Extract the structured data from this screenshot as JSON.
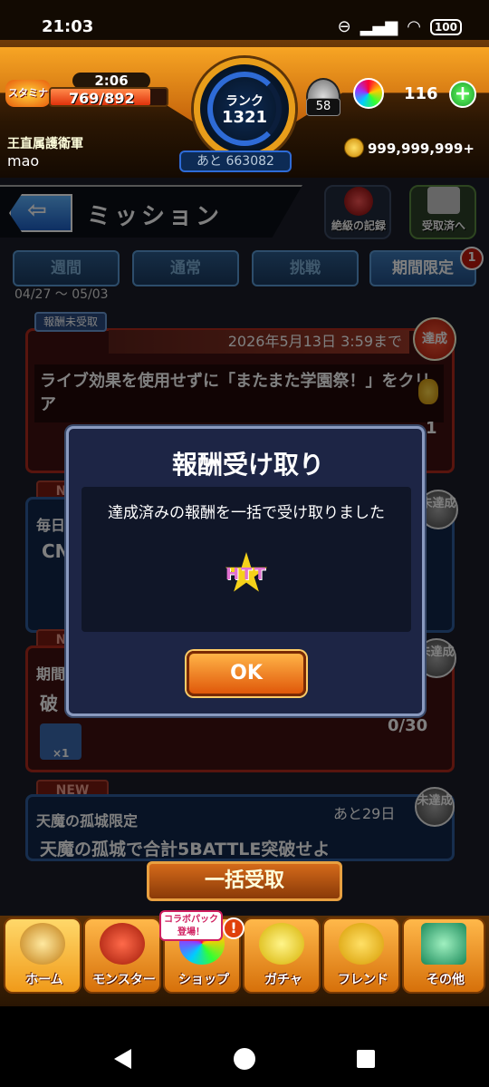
{
  "status": {
    "time": "21:03",
    "battery": "100"
  },
  "hud": {
    "stamina_icon": "スタミナ",
    "stamina_timer": "2:06",
    "stamina_value": "769/892",
    "stamina_fraction": 0.862,
    "rank_label": "ランク",
    "rank_value": "1321",
    "rank_next": "あと 663082",
    "level": "58",
    "orbs": "116",
    "team": "王直属護衛軍",
    "user": "mao",
    "coins": "999,999,999+"
  },
  "header": {
    "title": "ミッション",
    "record_label": "絶級の記録",
    "received_label": "受取済へ"
  },
  "tabs": [
    {
      "label": "週間"
    },
    {
      "label": "通常"
    },
    {
      "label": "挑戦"
    },
    {
      "label": "期間限定"
    }
  ],
  "tab_badge": "1",
  "period": "04/27 ～ 05/03",
  "missions": {
    "tag": "報酬未受取",
    "first_date": "2026年5月13日 3:59まで",
    "first_text": "ライブ効果を使用せずに「またまた学園祭！」をクリア",
    "first_progress": "1",
    "done": "達成",
    "undone": "未達成",
    "new": "NEW",
    "m2_label": "毎日",
    "m2_text": "CN",
    "m3_label": "期間",
    "m3_text": "破",
    "m3_progress": "0/30",
    "m3_count": "×1",
    "m4_title": "天魔の孤城限定",
    "m4_days": "あと29日",
    "m4_text": "天魔の孤城で合計5BATTLE突破せよ"
  },
  "dialog": {
    "title": "報酬受け取り",
    "message": "達成済みの報酬を一括で受け取りました",
    "reward": "HTT",
    "ok": "OK"
  },
  "bulk_label": "一括受取",
  "nav": [
    {
      "label": "ホーム"
    },
    {
      "label": "モンスター"
    },
    {
      "label": "ショップ"
    },
    {
      "label": "ガチャ"
    },
    {
      "label": "フレンド"
    },
    {
      "label": "その他"
    }
  ],
  "collab": "コラボパック登場！",
  "collab_alert": "!"
}
